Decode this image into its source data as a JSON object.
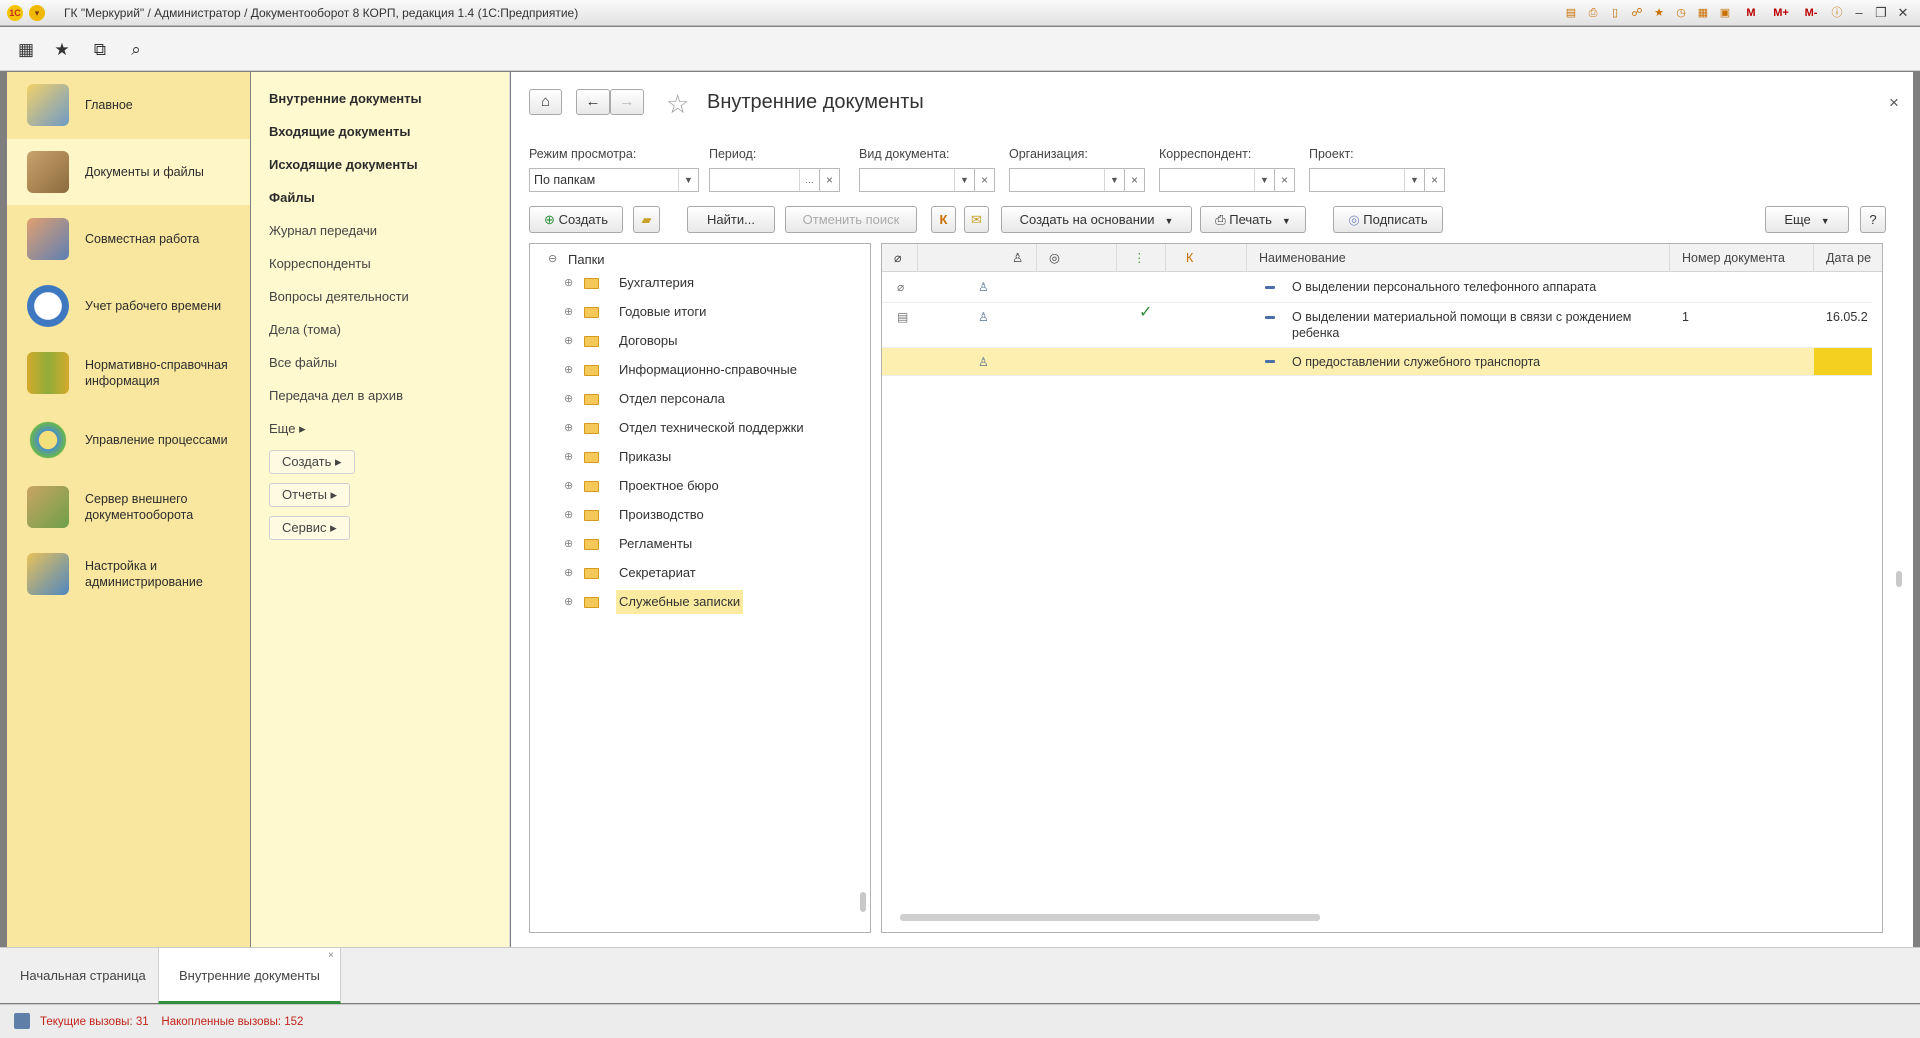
{
  "window": {
    "title": "ГК \"Меркурий\" / Администратор / Документооборот 8 КОРП, редакция 1.4  (1С:Предприятие)",
    "logo_text": "1C",
    "toolbar_m_labels": [
      "M",
      "M+",
      "M-"
    ]
  },
  "sections": [
    {
      "label": "Главное",
      "icon": "desk-lamp-icon"
    },
    {
      "label": "Документы и файлы",
      "icon": "documents-icon"
    },
    {
      "label": "Совместная работа",
      "icon": "people-icon"
    },
    {
      "label": "Учет рабочего времени",
      "icon": "clock-icon"
    },
    {
      "label": "Нормативно-справочная информация",
      "icon": "binders-icon"
    },
    {
      "label": "Управление процессами",
      "icon": "process-icon"
    },
    {
      "label": "Сервер внешнего документооборота",
      "icon": "server-icon"
    },
    {
      "label": "Настройка и администрирование",
      "icon": "admin-icon"
    }
  ],
  "nav": {
    "bold_items": [
      "Внутренние документы",
      "Входящие документы",
      "Исходящие документы",
      "Файлы"
    ],
    "items": [
      "Журнал передачи",
      "Корреспонденты",
      "Вопросы деятельности",
      "Дела (тома)",
      "Все файлы",
      "Передача дел в архив"
    ],
    "more": "Еще ▸",
    "buttons": [
      "Создать ▸",
      "Отчеты ▸",
      "Сервис ▸"
    ]
  },
  "form": {
    "title": "Внутренние документы",
    "close": "×",
    "filters": {
      "view_mode_label": "Режим просмотра:",
      "view_mode_value": "По папкам",
      "period_label": "Период:",
      "period_value": "",
      "doc_type_label": "Вид документа:",
      "org_label": "Организация:",
      "correspondent_label": "Корреспондент:",
      "project_label": "Проект:"
    },
    "toolbar": {
      "create": "Создать",
      "find": "Найти...",
      "cancel_search": "Отменить поиск",
      "k": "К",
      "create_based": "Создать на основании",
      "print": "Печать",
      "sign": "Подписать",
      "more": "Еще",
      "help": "?"
    },
    "tree": {
      "root": "Папки",
      "folders": [
        "Бухгалтерия",
        "Годовые итоги",
        "Договоры",
        "Информационно-справочные",
        "Отдел персонала",
        "Отдел технической поддержки",
        "Приказы",
        "Проектное бюро",
        "Производство",
        "Регламенты",
        "Секретариат",
        "Служебные записки"
      ],
      "selected": "Служебные записки"
    },
    "grid": {
      "columns": [
        "",
        "",
        "",
        "",
        "К",
        "Наименование",
        "Номер документа",
        "Дата ре"
      ],
      "rows": [
        {
          "name": "О выделении персонального телефонного аппарата",
          "number": "",
          "date": "",
          "checked": ""
        },
        {
          "name": "О выделении материальной помощи в связи с рождением ребенка",
          "number": "1",
          "date": "16.05.2",
          "checked": "✓"
        },
        {
          "name": "О предоставлении служебного транспорта",
          "number": "",
          "date": "",
          "checked": ""
        }
      ]
    }
  },
  "tabs": [
    "Начальная страница",
    "Внутренние документы"
  ],
  "status": {
    "current_calls": "Текущие вызовы: 31",
    "accumulated_calls": "Накопленные вызовы: 152"
  },
  "colors": {
    "sections_bg": "#f9e7a0",
    "nav_bg": "#fff9d0",
    "selected_row": "#fcefb0",
    "accent_green": "#2f8f3a"
  }
}
